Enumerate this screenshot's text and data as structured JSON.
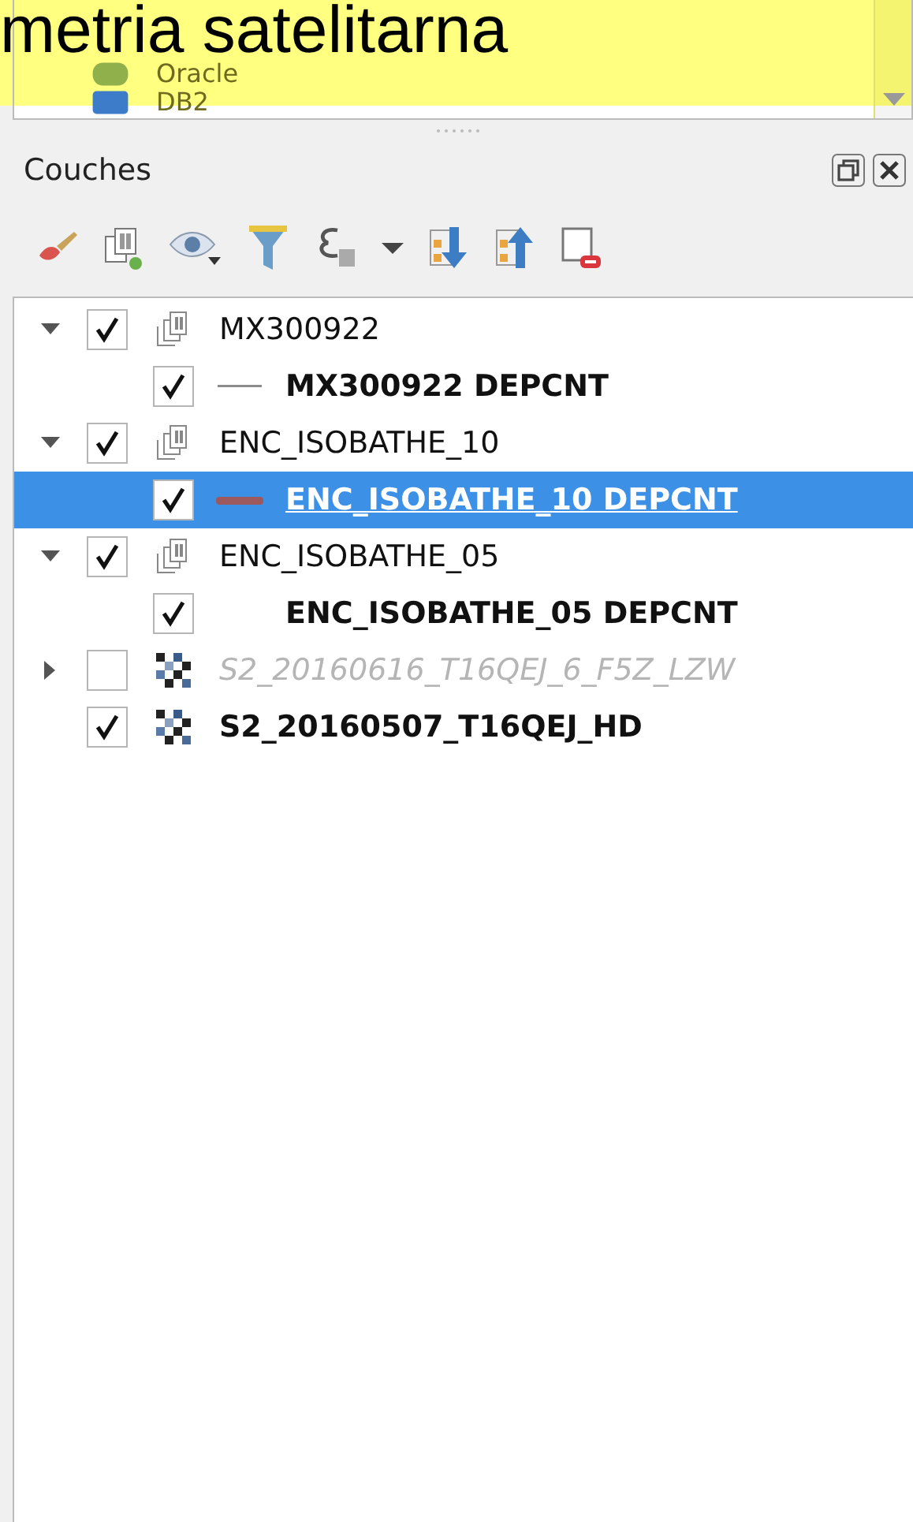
{
  "overlay_caption": "metria satelitarna",
  "browser": {
    "items": [
      {
        "label": "Oracle",
        "kind": "oracle"
      },
      {
        "label": "DB2",
        "kind": "db2"
      }
    ]
  },
  "panel": {
    "title": "Couches"
  },
  "layers": [
    {
      "name": "MX300922",
      "kind": "group",
      "checked": true,
      "expanded": true,
      "selected": false,
      "children": [
        {
          "name": "MX300922 DEPCNT",
          "checked": true,
          "selected": false,
          "symbol": {
            "kind": "thin",
            "color": "#8c8c8c"
          }
        }
      ]
    },
    {
      "name": "ENC_ISOBATHE_10",
      "kind": "group",
      "checked": true,
      "expanded": true,
      "selected": false,
      "children": [
        {
          "name": "ENC_ISOBATHE_10 DEPCNT",
          "checked": true,
          "selected": true,
          "symbol": {
            "kind": "thick",
            "color": "#9c5a5e"
          }
        }
      ]
    },
    {
      "name": "ENC_ISOBATHE_05",
      "kind": "group",
      "checked": true,
      "expanded": true,
      "selected": false,
      "children": [
        {
          "name": "ENC_ISOBATHE_05 DEPCNT",
          "checked": true,
          "selected": false
        }
      ]
    },
    {
      "name": "S2_20160616_T16QEJ_6_F5Z_LZW",
      "kind": "raster",
      "checked": false,
      "expanded": false,
      "selected": false
    },
    {
      "name": "S2_20160507_T16QEJ_HD",
      "kind": "raster",
      "checked": true,
      "selected": false
    }
  ]
}
